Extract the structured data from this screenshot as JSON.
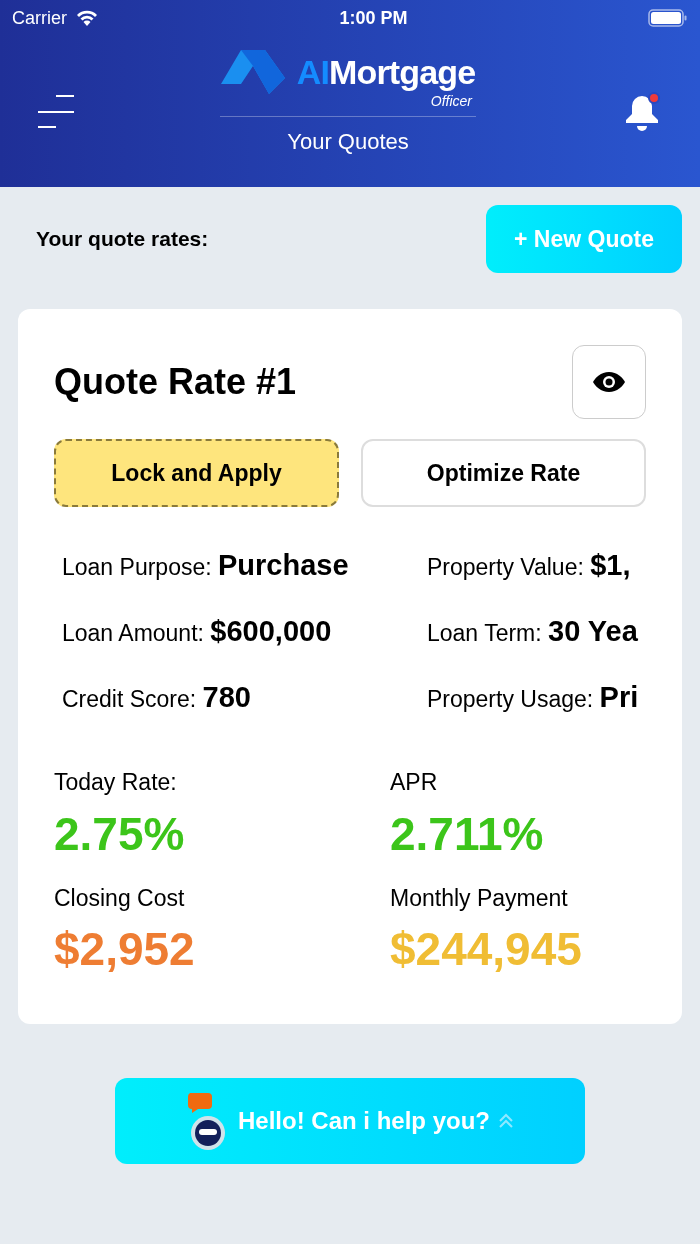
{
  "status_bar": {
    "carrier": "Carrier",
    "time": "1:00 PM"
  },
  "header": {
    "logo_prefix": "AI",
    "logo_name": "Mortgage",
    "logo_tagline": "Officer",
    "title": "Your Quotes",
    "has_notification": true
  },
  "section_label": "Your quote rates:",
  "new_quote_button": "+ New Quote",
  "quote": {
    "title": "Quote Rate #1",
    "actions": [
      {
        "label": "Lock and Apply",
        "kind": "primary"
      },
      {
        "label": "Optimize Rate",
        "kind": "secondary"
      }
    ],
    "details": [
      {
        "label": "Loan Purpose:",
        "value": "Purchase"
      },
      {
        "label": "Property Value:",
        "value": "$1,"
      },
      {
        "label": "Loan Amount:",
        "value": "$600,000"
      },
      {
        "label": "Loan Term:",
        "value": "30 Yea"
      },
      {
        "label": "Credit Score:",
        "value": "780"
      },
      {
        "label": "Property Usage:",
        "value": "Pri"
      }
    ],
    "metrics": [
      {
        "label": "Today Rate:",
        "value": "2.75%",
        "color": "#3cc51a"
      },
      {
        "label": "APR",
        "value": "2.711%",
        "color": "#3cc51a"
      },
      {
        "label": "Closing Cost",
        "value": "$2,952",
        "color": "#ee7d33"
      },
      {
        "label": "Monthly Payment",
        "value": "$244,945",
        "color": "#f0bd34"
      }
    ]
  },
  "chat_button": "Hello! Can i help you?"
}
